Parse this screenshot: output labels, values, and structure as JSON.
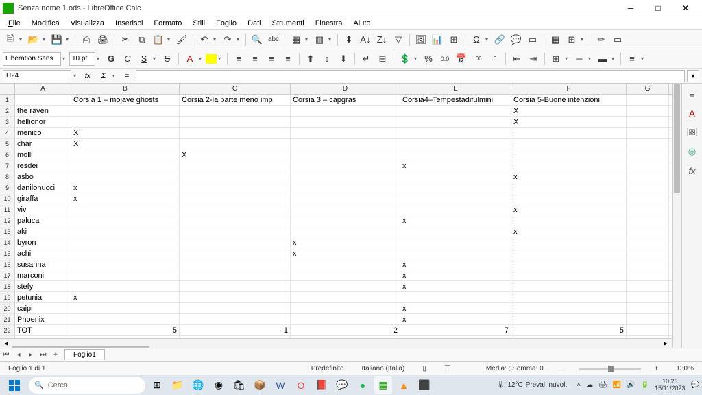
{
  "window": {
    "title": "Senza nome 1.ods - LibreOffice Calc"
  },
  "menu": [
    "File",
    "Modifica",
    "Visualizza",
    "Inserisci",
    "Formato",
    "Stili",
    "Foglio",
    "Dati",
    "Strumenti",
    "Finestra",
    "Aiuto"
  ],
  "font": {
    "name": "Liberation Sans",
    "size": "10 pt"
  },
  "formulaBar": {
    "ref": "H24",
    "value": ""
  },
  "columns": [
    "A",
    "B",
    "C",
    "D",
    "E",
    "F",
    "G"
  ],
  "rows": [
    {
      "n": 1,
      "A": "",
      "B": "Corsia 1 – mojave ghosts",
      "C": "Corsia 2-la parte meno imp",
      "D": "Corsia 3 – capgras",
      "E": "Corsia4–Tempestadifulmini",
      "F": "Corsia 5-Buone intenzioni",
      "G": ""
    },
    {
      "n": 2,
      "A": "the raven",
      "B": "",
      "C": "",
      "D": "",
      "E": "",
      "F": "X",
      "G": ""
    },
    {
      "n": 3,
      "A": "hellionor",
      "B": "",
      "C": "",
      "D": "",
      "E": "",
      "F": "X",
      "G": ""
    },
    {
      "n": 4,
      "A": "menico",
      "B": "X",
      "C": "",
      "D": "",
      "E": "",
      "F": "",
      "G": ""
    },
    {
      "n": 5,
      "A": "char",
      "B": "X",
      "C": "",
      "D": "",
      "E": "",
      "F": "",
      "G": ""
    },
    {
      "n": 6,
      "A": "molli",
      "B": "",
      "C": "X",
      "D": "",
      "E": "",
      "F": "",
      "G": ""
    },
    {
      "n": 7,
      "A": "resdei",
      "B": "",
      "C": "",
      "D": "",
      "E": "x",
      "F": "",
      "G": ""
    },
    {
      "n": 8,
      "A": "asbo",
      "B": "",
      "C": "",
      "D": "",
      "E": "",
      "F": "x",
      "G": ""
    },
    {
      "n": 9,
      "A": "danilonucci",
      "B": "x",
      "C": "",
      "D": "",
      "E": "",
      "F": "",
      "G": ""
    },
    {
      "n": 10,
      "A": "giraffa",
      "B": "x",
      "C": "",
      "D": "",
      "E": "",
      "F": "",
      "G": ""
    },
    {
      "n": 11,
      "A": "viv",
      "B": "",
      "C": "",
      "D": "",
      "E": "",
      "F": "x",
      "G": ""
    },
    {
      "n": 12,
      "A": "paluca",
      "B": "",
      "C": "",
      "D": "",
      "E": "x",
      "F": "",
      "G": ""
    },
    {
      "n": 13,
      "A": "aki",
      "B": "",
      "C": "",
      "D": "",
      "E": "",
      "F": "x",
      "G": ""
    },
    {
      "n": 14,
      "A": "byron",
      "B": "",
      "C": "",
      "D": "x",
      "E": "",
      "F": "",
      "G": ""
    },
    {
      "n": 15,
      "A": "achi",
      "B": "",
      "C": "",
      "D": "x",
      "E": "",
      "F": "",
      "G": ""
    },
    {
      "n": 16,
      "A": "susanna",
      "B": "",
      "C": "",
      "D": "",
      "E": "x",
      "F": "",
      "G": ""
    },
    {
      "n": 17,
      "A": "marconi",
      "B": "",
      "C": "",
      "D": "",
      "E": "x",
      "F": "",
      "G": ""
    },
    {
      "n": 18,
      "A": "stefy",
      "B": "",
      "C": "",
      "D": "",
      "E": "x",
      "F": "",
      "G": ""
    },
    {
      "n": 19,
      "A": "petunia",
      "B": "x",
      "C": "",
      "D": "",
      "E": "",
      "F": "",
      "G": ""
    },
    {
      "n": 20,
      "A": "caipi",
      "B": "",
      "C": "",
      "D": "",
      "E": "x",
      "F": "",
      "G": ""
    },
    {
      "n": 21,
      "A": "Phoenix",
      "B": "",
      "C": "",
      "D": "",
      "E": "x",
      "F": "",
      "G": ""
    },
    {
      "n": 22,
      "A": "TOT",
      "B": "5",
      "C": "1",
      "D": "2",
      "E": "7",
      "F": "5",
      "G": "",
      "num": true
    }
  ],
  "sheetTab": "Foglio1",
  "status": {
    "sheet": "Foglio 1 di 1",
    "style": "Predefinito",
    "lang": "Italiano (Italia)",
    "summary": "Media: ; Somma: 0",
    "zoom": "130%"
  },
  "taskbar": {
    "search": "Cerca",
    "weather_temp": "12°C",
    "weather_desc": "Preval. nuvol.",
    "time": "10:23",
    "date": "15/11/2023"
  }
}
